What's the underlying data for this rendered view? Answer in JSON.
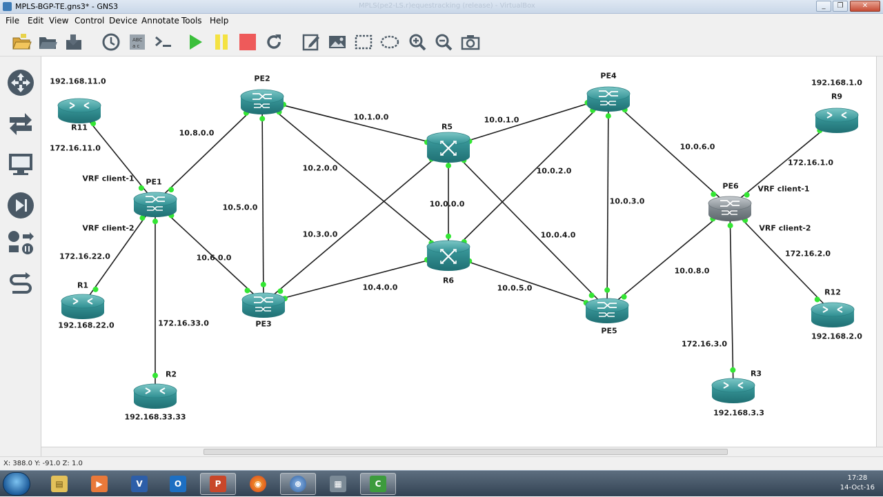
{
  "window": {
    "title": "MPLS-BGP-TE.gns3* - GNS3",
    "background_title": "MPLS(pe2-LS.r)equestracking (release) - VirtualBox"
  },
  "menu": [
    "File",
    "Edit",
    "View",
    "Control",
    "Device",
    "Annotate",
    "Tools",
    "Help"
  ],
  "toolbar": {
    "items": [
      "open-folder-icon",
      "open-project-icon",
      "save-icon",
      "snapshot-clock-icon",
      "console-all-icon",
      "terminal-icon",
      "start-all-icon",
      "suspend-all-icon",
      "stop-all-icon",
      "reload-all-icon",
      "add-note-icon",
      "insert-image-icon",
      "draw-rectangle-icon",
      "draw-ellipse-icon",
      "zoom-in-icon",
      "zoom-out-icon",
      "screenshot-icon"
    ]
  },
  "devices_panel": [
    "routers-icon",
    "switches-icon",
    "end-devices-icon",
    "security-devices-icon",
    "all-devices-icon",
    "add-link-icon"
  ],
  "topology": {
    "nodes": [
      {
        "id": "R11",
        "label": "R11",
        "type": "router"
      },
      {
        "id": "PE1",
        "label": "PE1",
        "type": "switch-router"
      },
      {
        "id": "R1",
        "label": "R1",
        "type": "router"
      },
      {
        "id": "R2",
        "label": "R2",
        "type": "router"
      },
      {
        "id": "PE2",
        "label": "PE2",
        "type": "switch-router"
      },
      {
        "id": "PE3",
        "label": "PE3",
        "type": "switch-router"
      },
      {
        "id": "R5",
        "label": "R5",
        "type": "atm-router"
      },
      {
        "id": "R6",
        "label": "R6",
        "type": "atm-router"
      },
      {
        "id": "PE4",
        "label": "PE4",
        "type": "switch-router"
      },
      {
        "id": "PE5",
        "label": "PE5",
        "type": "switch-router"
      },
      {
        "id": "PE6",
        "label": "PE6",
        "type": "switch-router-selected"
      },
      {
        "id": "R9",
        "label": "R9",
        "type": "router"
      },
      {
        "id": "R12",
        "label": "R12",
        "type": "router"
      },
      {
        "id": "R3",
        "label": "R3",
        "type": "router"
      }
    ],
    "links": [
      {
        "a": "R11",
        "b": "PE1",
        "label": "172.16.11.0"
      },
      {
        "a": "PE1",
        "b": "R1",
        "label": "172.16.22.0"
      },
      {
        "a": "PE1",
        "b": "R2",
        "label": "172.16.33.0"
      },
      {
        "a": "PE1",
        "b": "PE2",
        "label": "10.8.0.0"
      },
      {
        "a": "PE1",
        "b": "PE3",
        "label": "10.6.0.0"
      },
      {
        "a": "PE2",
        "b": "PE3",
        "label": "10.5.0.0"
      },
      {
        "a": "PE2",
        "b": "R5",
        "label": "10.1.0.0"
      },
      {
        "a": "PE2",
        "b": "R6",
        "label": "10.2.0.0"
      },
      {
        "a": "PE3",
        "b": "R5",
        "label": "10.3.0.0"
      },
      {
        "a": "PE3",
        "b": "R6",
        "label": "10.4.0.0"
      },
      {
        "a": "R5",
        "b": "R6",
        "label": "10.0.0.0"
      },
      {
        "a": "R5",
        "b": "PE4",
        "label": "10.0.1.0"
      },
      {
        "a": "R6",
        "b": "PE4",
        "label": "10.0.2.0"
      },
      {
        "a": "R5",
        "b": "PE5",
        "label": "10.0.4.0"
      },
      {
        "a": "R6",
        "b": "PE5",
        "label": "10.0.5.0"
      },
      {
        "a": "PE4",
        "b": "PE5",
        "label": "10.0.3.0"
      },
      {
        "a": "PE4",
        "b": "PE6",
        "label": "10.0.6.0"
      },
      {
        "a": "PE5",
        "b": "PE6",
        "label": "10.0.8.0"
      },
      {
        "a": "PE6",
        "b": "R9",
        "label": "172.16.1.0"
      },
      {
        "a": "PE6",
        "b": "R12",
        "label": "172.16.2.0"
      },
      {
        "a": "PE6",
        "b": "R3",
        "label": "172.16.3.0"
      }
    ],
    "notes": [
      "192.168.11.0",
      "192.168.22.0",
      "192.168.33.33",
      "192.168.1.0",
      "192.168.2.0",
      "192.168.3.3",
      "VRF client-1",
      "VRF client-2",
      "VRF client-1",
      "VRF client-2"
    ]
  },
  "colors": {
    "router_teal": "#3d9a9c",
    "link_endpoint": "#33e633",
    "selected_router": "#8a9196"
  },
  "statusbar": {
    "coords": "X: 388.0 Y: -91.0 Z: 1.0"
  },
  "taskbar": {
    "apps": [
      "explorer-icon",
      "media-player-icon",
      "visio-icon",
      "outlook-icon",
      "powerpoint-icon",
      "firefox-icon",
      "gns3-icon",
      "virtualbox-icon",
      "camtasia-icon"
    ],
    "clock_time": "17:28",
    "clock_date": "14-Oct-16"
  }
}
